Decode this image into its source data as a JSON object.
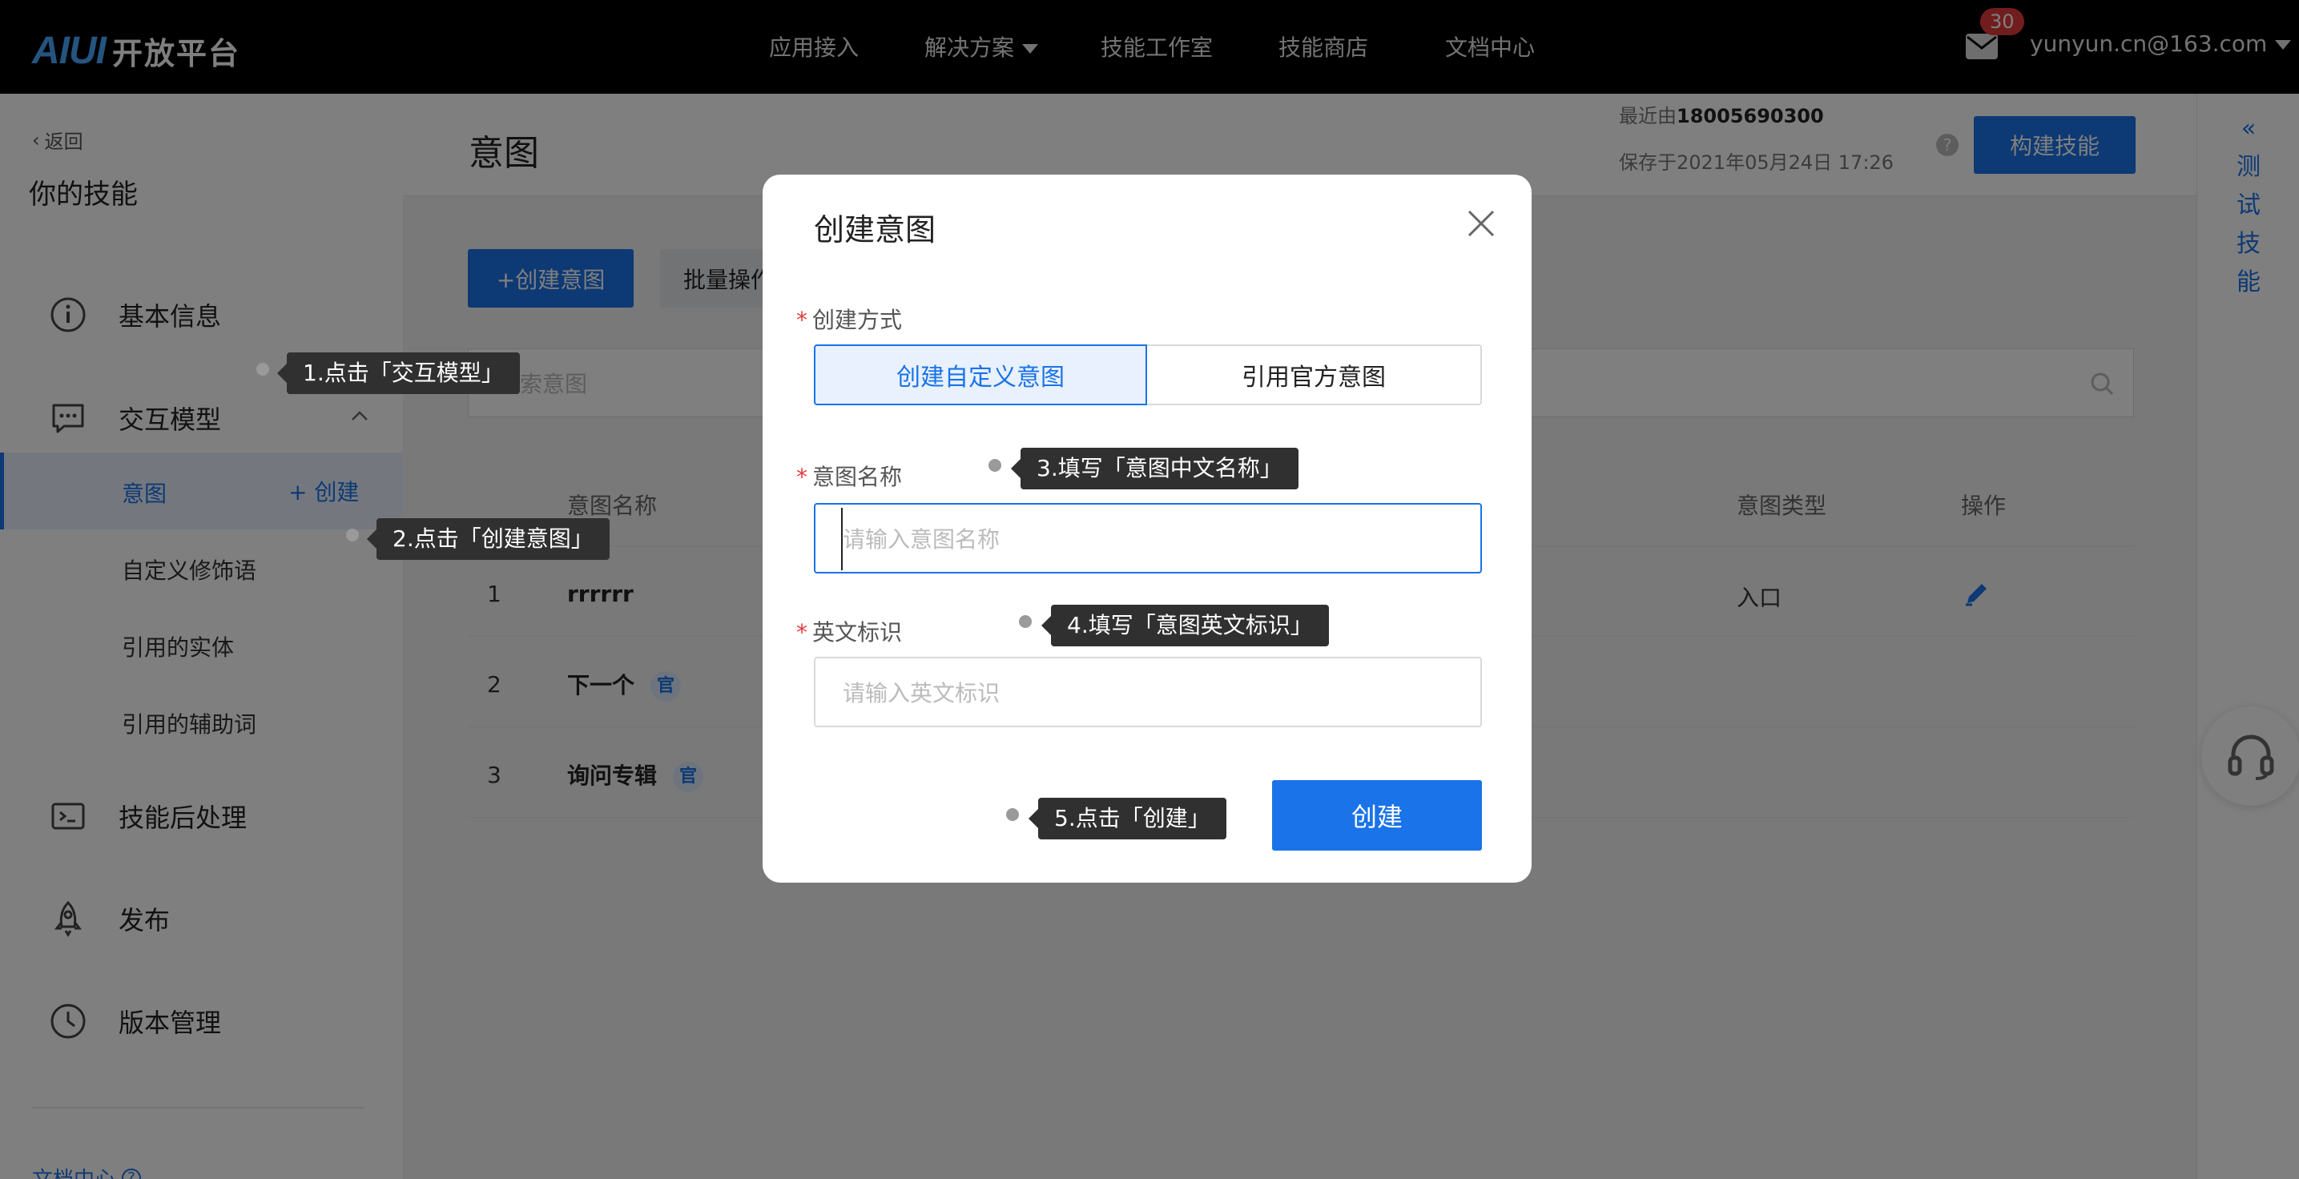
{
  "topbar": {
    "logo_mark": "AIUI",
    "logo_text": "开放平台",
    "nav": [
      "应用接入",
      "解决方案",
      "技能工作室",
      "技能商店",
      "文档中心"
    ],
    "mail_count": "30",
    "user_email": "yunyun.cn@163.com"
  },
  "sidebar": {
    "back": "返回",
    "title": "你的技能",
    "items": {
      "basic_info": "基本信息",
      "interaction_model": "交互模型",
      "post_process": "技能后处理",
      "publish": "发布",
      "version_mgmt": "版本管理"
    },
    "sub_items": {
      "intent": "意图",
      "intent_create": "创建",
      "custom_modifier": "自定义修饰语",
      "ref_entity": "引用的实体",
      "ref_aux": "引用的辅助词"
    },
    "doc_center": "文档中心"
  },
  "main": {
    "page_title": "意图",
    "recent_by_prefix": "最近由",
    "recent_by_user": "18005690300",
    "saved_at": "保存于2021年05月24日 17:26",
    "help": "?",
    "build_button": "构建技能",
    "create_intent_button": "+创建意图",
    "batch_button": "批量操作",
    "search_placeholder": "搜索意图",
    "table": {
      "headers": {
        "name": "意图名称",
        "type": "意图类型",
        "action": "操作"
      },
      "rows": [
        {
          "index": "1",
          "name": "rrrrrr",
          "official": "",
          "type": "入口"
        },
        {
          "index": "2",
          "name": "下一个",
          "official": "官",
          "type": ""
        },
        {
          "index": "3",
          "name": "询问专辑",
          "official": "官",
          "type": ""
        }
      ]
    }
  },
  "right_panel": {
    "test_skill": [
      "测",
      "试",
      "技",
      "能"
    ]
  },
  "modal": {
    "title": "创建意图",
    "method_label": "创建方式",
    "method_options": [
      "创建自定义意图",
      "引用官方意图"
    ],
    "name_label": "意图名称",
    "name_placeholder": "请输入意图名称",
    "english_label": "英文标识",
    "english_placeholder": "请输入英文标识",
    "create_button": "创建"
  },
  "tips": {
    "t1": "1.点击「交互模型」",
    "t2": "2.点击「创建意图」",
    "t3": "3.填写「意图中文名称」",
    "t4": "4.填写「意图英文标识」",
    "t5": "5.点击「创建」"
  },
  "colors": {
    "primary": "#1a73e8",
    "topbar": "#000000",
    "badge": "#e23b3b",
    "tooltip": "#303030"
  }
}
